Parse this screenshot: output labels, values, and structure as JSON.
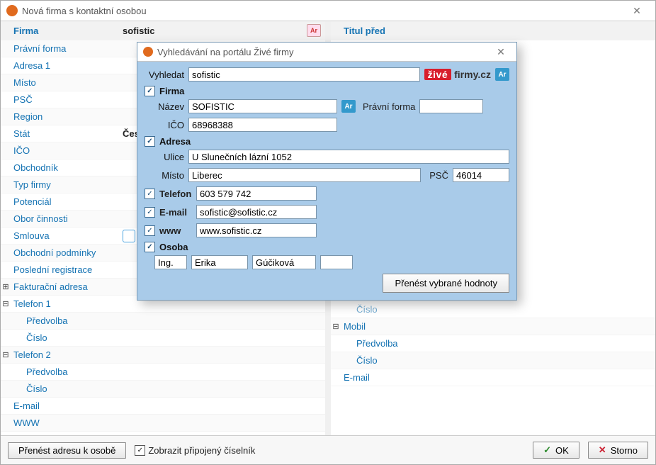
{
  "window": {
    "title": "Nová firma s kontaktní osobou"
  },
  "left": {
    "rows": [
      {
        "label": "Firma",
        "value": "sofistic",
        "top": true,
        "hasBadge": true,
        "badgeGlyph": "Ar"
      },
      {
        "label": "Právní forma"
      },
      {
        "label": "Adresa 1"
      },
      {
        "label": "Místo"
      },
      {
        "label": "PSČ"
      },
      {
        "label": "Region"
      },
      {
        "label": "Stát",
        "value": "Česk"
      },
      {
        "label": "IČO"
      },
      {
        "label": "Obchodník"
      },
      {
        "label": "Typ firmy"
      },
      {
        "label": "Potenciál"
      },
      {
        "label": "Obor činnosti"
      },
      {
        "label": "Smlouva",
        "hasCheckbox": true
      },
      {
        "label": "Obchodní podmínky"
      },
      {
        "label": "Poslední registrace"
      },
      {
        "label": "Fakturační adresa",
        "tree": "plus"
      },
      {
        "label": "Telefon 1",
        "tree": "minus"
      },
      {
        "label": "Předvolba",
        "indent": true
      },
      {
        "label": "Číslo",
        "indent": true
      },
      {
        "label": "Telefon 2",
        "tree": "minus"
      },
      {
        "label": "Předvolba",
        "indent": true
      },
      {
        "label": "Číslo",
        "indent": true
      },
      {
        "label": "E-mail"
      },
      {
        "label": "WWW"
      }
    ]
  },
  "right": {
    "rows": [
      {
        "label": "Titul před",
        "top": true
      },
      {
        "label": "Číslo",
        "indent": true,
        "dim": true
      },
      {
        "label": "Mobil",
        "tree": "minus"
      },
      {
        "label": "Předvolba",
        "indent": true
      },
      {
        "label": "Číslo",
        "indent": true
      },
      {
        "label": "E-mail"
      }
    ]
  },
  "footer": {
    "transferButton": "Přenést adresu k osobě",
    "showLinked": "Zobrazit připojený číselník",
    "ok": "OK",
    "cancel": "Storno"
  },
  "modal": {
    "title": "Vyhledávání na portálu Živé firmy",
    "searchLabel": "Vyhledat",
    "searchValue": "sofistic",
    "branding": {
      "zive": "živé",
      "firmy": "firmy.cz",
      "ar": "Ar"
    },
    "sections": {
      "firma": {
        "label": "Firma",
        "nazevLabel": "Název",
        "nazev": "SOFISTIC",
        "pravniFormaLabel": "Právní forma",
        "pravniForma": "",
        "icoLabel": "IČO",
        "ico": "68968388"
      },
      "adresa": {
        "label": "Adresa",
        "uliceLabel": "Ulice",
        "ulice": "U Slunečních lázní 1052",
        "mistoLabel": "Místo",
        "misto": "Liberec",
        "pscLabel": "PSČ",
        "psc": "46014"
      },
      "telefon": {
        "label": "Telefon",
        "value": "603 579 742"
      },
      "email": {
        "label": "E-mail",
        "value": "sofistic@sofistic.cz"
      },
      "www": {
        "label": "www",
        "value": "www.sofistic.cz"
      },
      "osoba": {
        "label": "Osoba",
        "titul": "Ing.",
        "jmeno": "Erika",
        "prijmeni": "Gúčiková",
        "titulZa": ""
      }
    },
    "transferButton": "Přenést vybrané hodnoty"
  }
}
